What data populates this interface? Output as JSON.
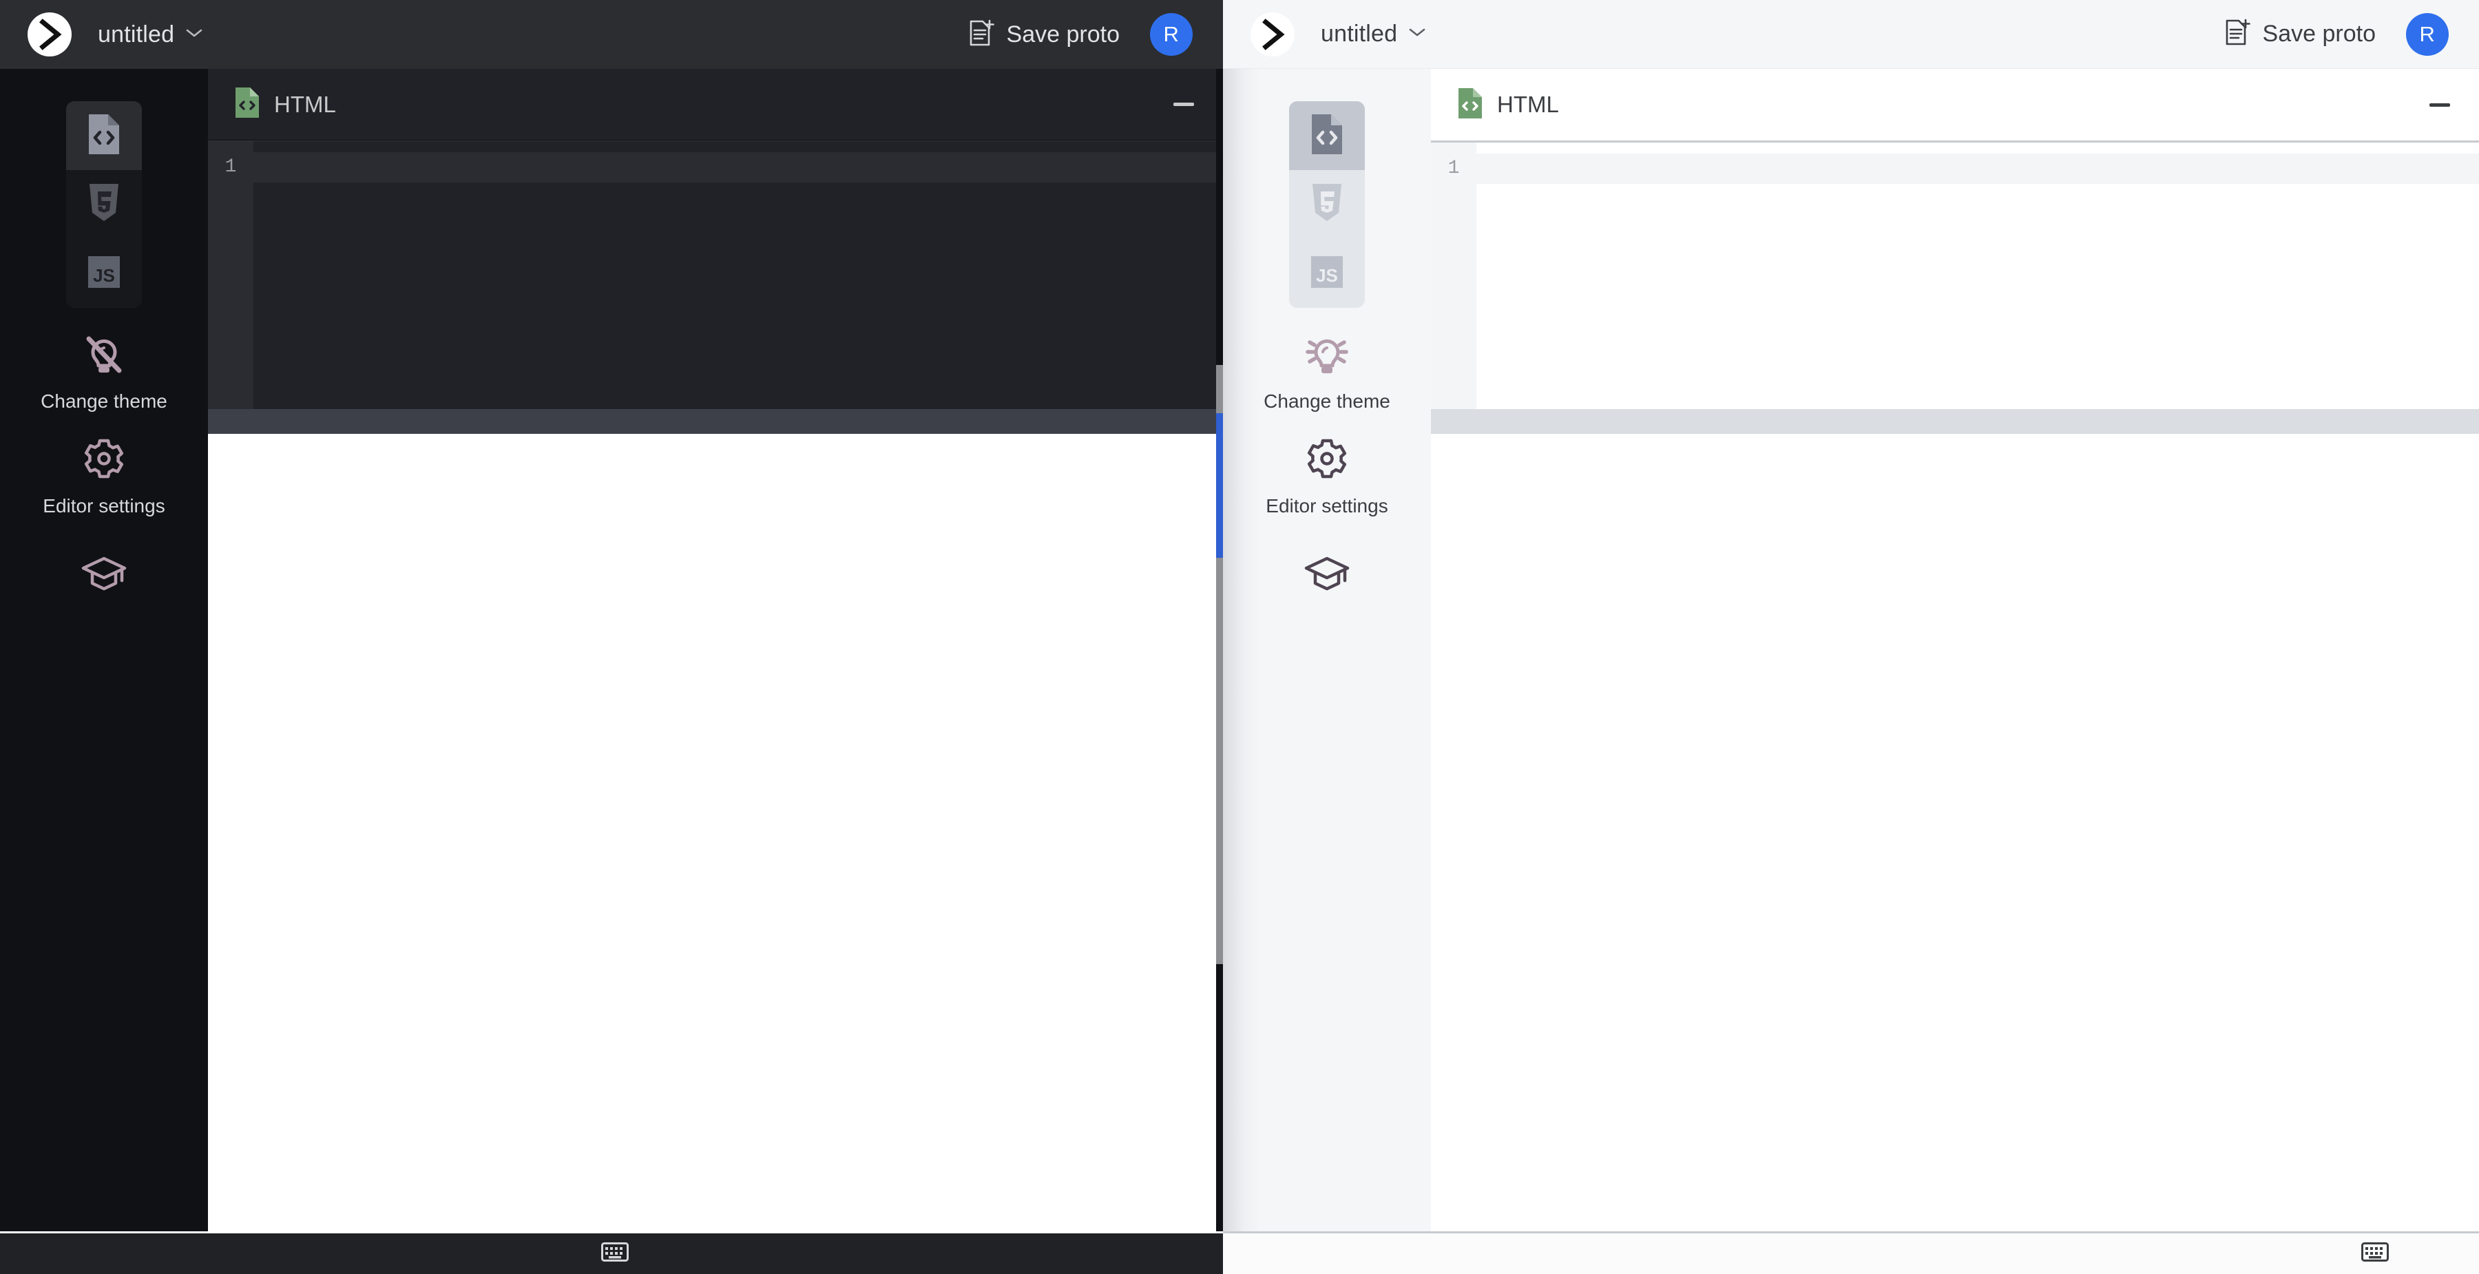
{
  "app": {
    "logo_icon": "chevron-right-logo-icon",
    "accent_color": "#2f6fed",
    "html_icon_color": "#6f9e6e"
  },
  "panels": [
    {
      "theme": "dark",
      "topbar": {
        "doc_title": "untitled",
        "title_dropdown_icon": "chevron-down-icon",
        "save_label": "Save proto",
        "save_icon": "document-add-icon",
        "avatar_initial": "R"
      },
      "sidebar": {
        "languages": [
          {
            "name": "html-file-icon",
            "label": "HTML",
            "active": true
          },
          {
            "name": "css3-icon",
            "label": "CSS",
            "active": false
          },
          {
            "name": "javascript-icon",
            "label": "JS",
            "active": false
          }
        ],
        "actions": [
          {
            "icon": "lightbulb-off-icon",
            "label": "Change theme"
          },
          {
            "icon": "gear-icon",
            "label": "Editor settings"
          },
          {
            "icon": "graduation-cap-icon",
            "label": ""
          }
        ]
      },
      "editor": {
        "file_icon": "html-file-icon",
        "file_label": "HTML",
        "minimize_icon": "minimize-icon",
        "line_numbers": [
          "1"
        ],
        "code_lines": [
          ""
        ]
      },
      "bottombar": {
        "keyboard_icon": "keyboard-icon"
      }
    },
    {
      "theme": "light",
      "topbar": {
        "doc_title": "untitled",
        "title_dropdown_icon": "chevron-down-icon",
        "save_label": "Save proto",
        "save_icon": "document-add-icon",
        "avatar_initial": "R"
      },
      "sidebar": {
        "languages": [
          {
            "name": "html-file-icon",
            "label": "HTML",
            "active": true
          },
          {
            "name": "css3-icon",
            "label": "CSS",
            "active": false
          },
          {
            "name": "javascript-icon",
            "label": "JS",
            "active": false
          }
        ],
        "actions": [
          {
            "icon": "lightbulb-on-icon",
            "label": "Change theme"
          },
          {
            "icon": "gear-icon",
            "label": "Editor settings"
          },
          {
            "icon": "graduation-cap-icon",
            "label": ""
          }
        ]
      },
      "editor": {
        "file_icon": "html-file-icon",
        "file_label": "HTML",
        "minimize_icon": "minimize-icon",
        "line_numbers": [
          "1"
        ],
        "code_lines": [
          ""
        ]
      },
      "bottombar": {
        "keyboard_icon": "keyboard-icon"
      }
    }
  ]
}
